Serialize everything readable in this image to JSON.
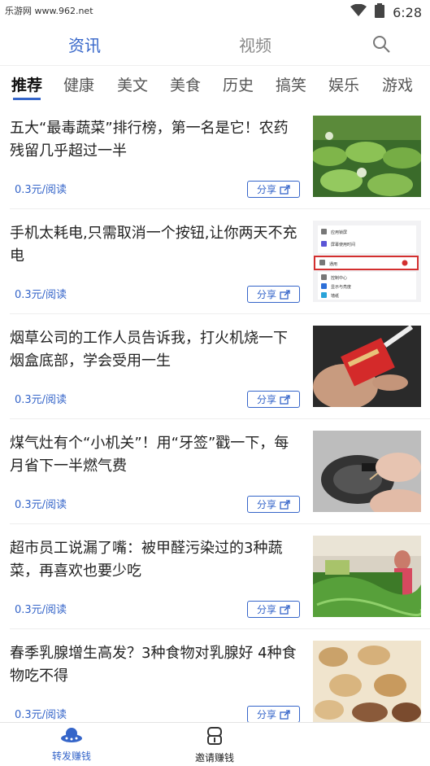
{
  "status_bar": {
    "site": "乐游网 www.962.net",
    "time": "6:28"
  },
  "top_nav": {
    "tabs": [
      {
        "label": "资讯"
      },
      {
        "label": "视频"
      }
    ]
  },
  "categories": [
    "推荐",
    "健康",
    "美文",
    "美食",
    "历史",
    "搞笑",
    "娱乐",
    "游戏"
  ],
  "feed": [
    {
      "title": "五大“最毒蔬菜”排行榜，第一名是它！农药残留几乎超过一半",
      "price": "0.3元/阅读",
      "share": "分享"
    },
    {
      "title": "手机太耗电,只需取消一个按钮,让你两天不充电",
      "price": "0.3元/阅读",
      "share": "分享"
    },
    {
      "title": "烟草公司的工作人员告诉我，打火机烧一下烟盒底部，学会受用一生",
      "price": "0.3元/阅读",
      "share": "分享"
    },
    {
      "title": "煤气灶有个“小机关”！用“牙签”戳一下，每月省下一半燃气费",
      "price": "0.3元/阅读",
      "share": "分享"
    },
    {
      "title": "超市员工说漏了嘴：被甲醛污染过的3种蔬菜，再喜欢也要少吃",
      "price": "0.3元/阅读",
      "share": "分享"
    },
    {
      "title": "春季乳腺增生高发？3种食物对乳腺好 4种食物吃不得",
      "price": "0.3元/阅读",
      "share": "分享"
    }
  ],
  "thumb_settings": {
    "rows": [
      "应用锁屏",
      "屏幕使用时间",
      "通用",
      "控制中心",
      "显示与亮度",
      "墙纸"
    ]
  },
  "bottom_bar": {
    "items": [
      {
        "label": "转发赚钱"
      },
      {
        "label": "邀请赚钱"
      }
    ]
  },
  "colors": {
    "accent": "#3565c9"
  }
}
